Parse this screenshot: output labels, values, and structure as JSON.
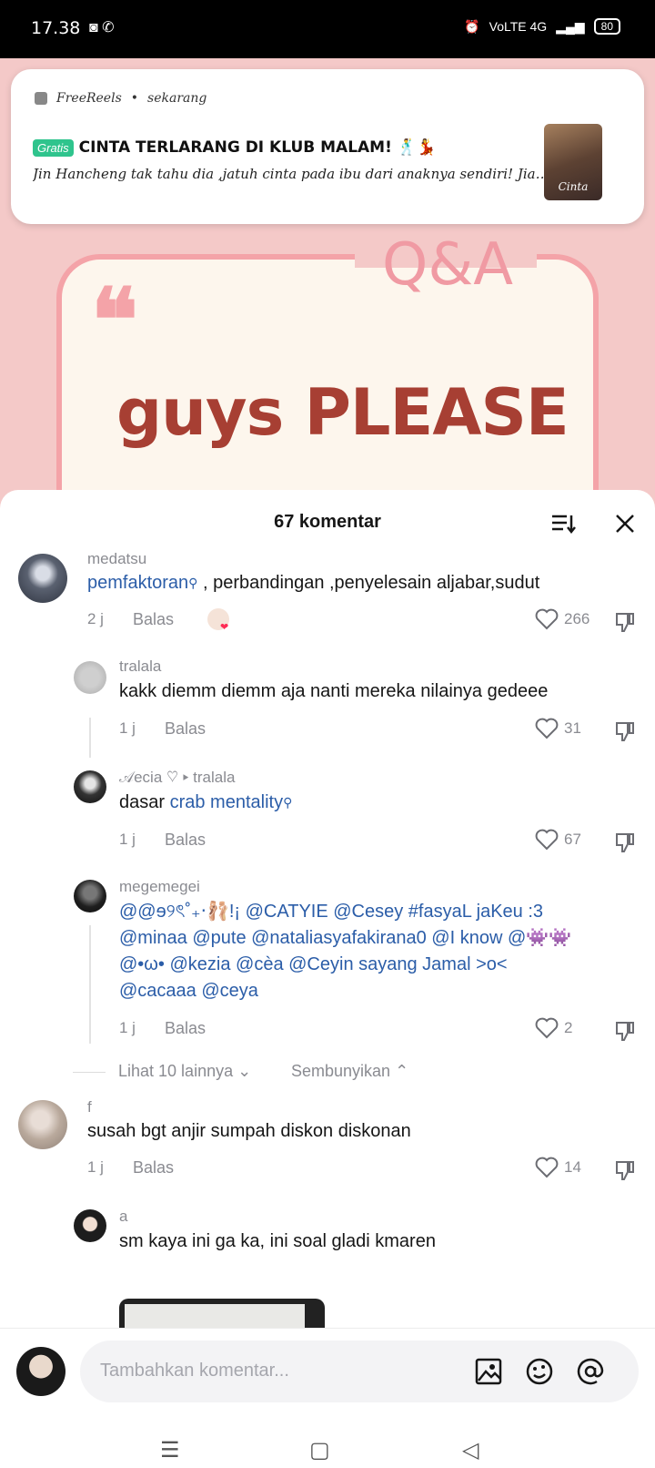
{
  "status_bar": {
    "time": "17.38",
    "network_label": "VoLTE 4G",
    "battery": "80"
  },
  "notification": {
    "app_name": "FreeReels",
    "time": "sekarang",
    "badge": "Gratis",
    "title": "CINTA TERLARANG DI KLUB MALAM! 🕺💃",
    "body": "Jin Hancheng tak tahu dia ,jatuh cinta pada ibu dari anaknya sendiri! Jiang...",
    "thumb_text": "Cinta"
  },
  "video": {
    "qa_label": "Q&A",
    "quote_mark": "❝",
    "title": "guys PLEASE"
  },
  "sheet": {
    "title": "67 komentar",
    "reply_label": "Balas"
  },
  "comments": [
    {
      "username": "medatsu",
      "link_text": "pemfaktoran",
      "text": " , perbandingan ,penyelesain aljabar,sudut",
      "time": "2 j",
      "likes": "266"
    },
    {
      "username": "tralala",
      "text": "kakk diemm diemm aja nanti mereka nilainya gedeee",
      "time": "1 j",
      "likes": "31"
    },
    {
      "username": "𝒜ecia ♡",
      "reply_to": "tralala",
      "text_prefix": "dasar ",
      "link_text": "crab mentality",
      "time": "1 j",
      "likes": "67"
    },
    {
      "username": "megemegei",
      "lines": [
        "@@ɘ୨ৎ˚₊‧🩰!¡ @CATYIE @Cesey #fasyaL jaKeu :3",
        "@minaa @pute @nataliasyafakirana0 @I know @👾👾",
        "@•ω• @kezia @cèa @Ceyin sayang Jamal >o<",
        "@cacaaa @ceya"
      ],
      "time": "1 j",
      "likes": "2"
    },
    {
      "username": "f",
      "text": "susah bgt anjir sumpah diskon diskonan",
      "time": "1 j",
      "likes": "14"
    },
    {
      "username": "a",
      "text": "sm kaya ini ga ka, ini soal gladi kmaren"
    }
  ],
  "view_more": {
    "label": "Lihat 10 lainnya",
    "hide_label": "Sembunyikan"
  },
  "input": {
    "placeholder": "Tambahkan komentar..."
  },
  "nav": {
    "menu": "☰",
    "home": "▢",
    "back": "◁"
  },
  "colors": {
    "link": "#2b5da8",
    "meta": "#8a8b91",
    "badge": "#2fc48d",
    "video_bg": "#f4c9c8",
    "video_title": "#a73f33"
  }
}
